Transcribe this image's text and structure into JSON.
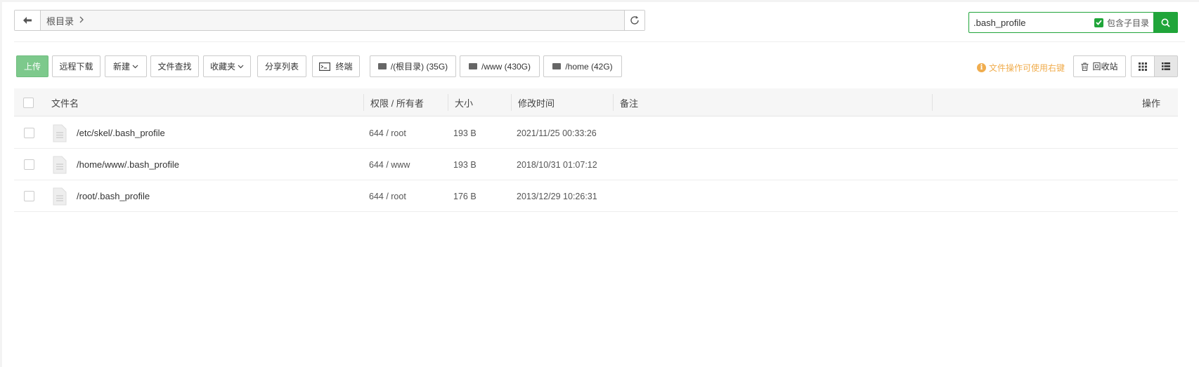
{
  "breadcrumb": {
    "root_label": "根目录"
  },
  "search": {
    "value": ".bash_profile",
    "include_subdir_label": "包含子目录"
  },
  "toolbar": {
    "upload": "上传",
    "remote_download": "远程下载",
    "new": "新建",
    "file_search": "文件查找",
    "favorites": "收藏夹",
    "share_list": "分享列表",
    "terminal": "终端",
    "disks": [
      "/(根目录) (35G)",
      "/www (430G)",
      "/home (42G)"
    ],
    "hint": "文件操作可使用右键",
    "recycle_bin": "回收站"
  },
  "table": {
    "headers": {
      "name": "文件名",
      "permission": "权限 / 所有者",
      "size": "大小",
      "mtime": "修改时间",
      "remark": "备注",
      "actions": "操作"
    },
    "rows": [
      {
        "name": "/etc/skel/.bash_profile",
        "permission": "644 / root",
        "size": "193 B",
        "mtime": "2021/11/25 00:33:26"
      },
      {
        "name": "/home/www/.bash_profile",
        "permission": "644 / www",
        "size": "193 B",
        "mtime": "2018/10/31 01:07:12"
      },
      {
        "name": "/root/.bash_profile",
        "permission": "644 / root",
        "size": "176 B",
        "mtime": "2013/12/29 10:26:31"
      }
    ]
  },
  "colors": {
    "accent": "#20a53a",
    "upload_bg": "#7dc98c",
    "hint": "#f0ad4e"
  },
  "icons": [
    "arrow-left-icon",
    "chevron-right-icon",
    "refresh-icon",
    "checkbox-checked-icon",
    "search-icon",
    "chevron-down-icon",
    "terminal-icon",
    "disk-icon",
    "info-icon",
    "trash-icon",
    "grid-view-icon",
    "list-view-icon",
    "file-icon"
  ]
}
